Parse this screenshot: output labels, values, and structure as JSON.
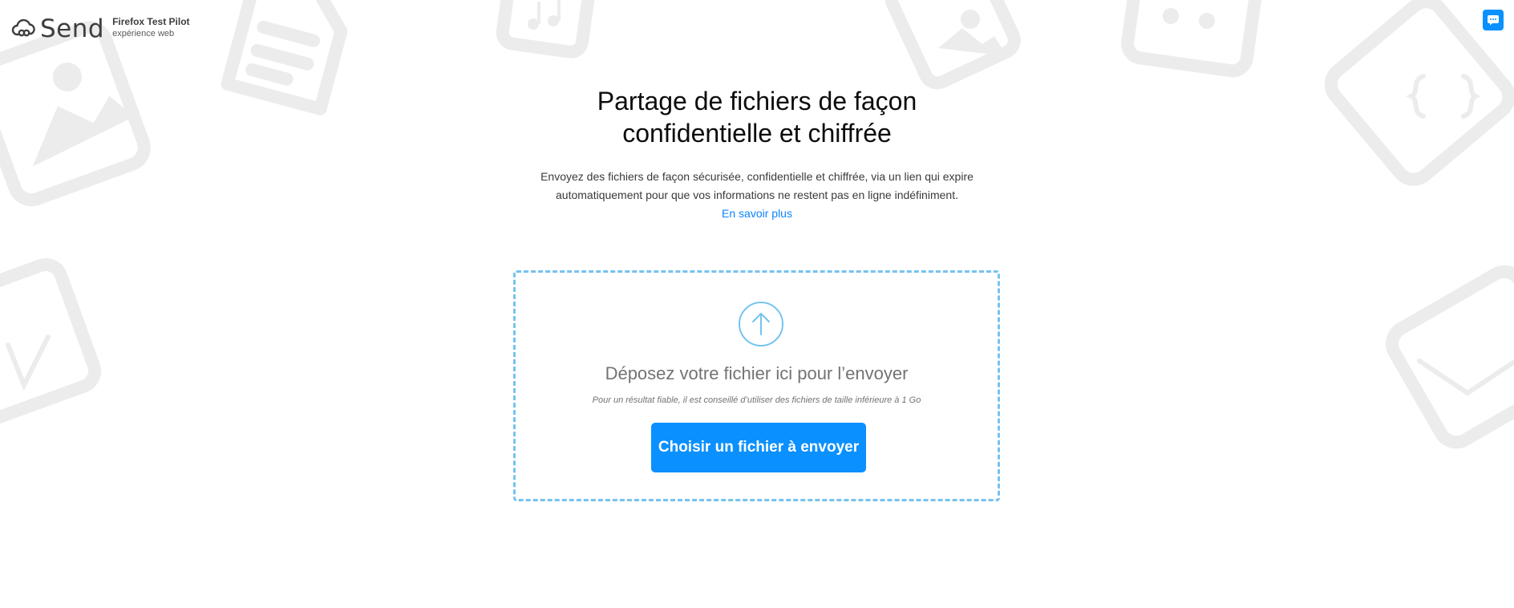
{
  "header": {
    "logo_text": "Send",
    "testpilot_title": "Firefox Test Pilot",
    "testpilot_subtitle": "expérience web"
  },
  "feedback": {
    "icon": "speech-bubble-icon"
  },
  "main": {
    "title_line1": "Partage de fichiers de façon",
    "title_line2": "confidentielle et chiffrée",
    "description_line1": "Envoyez des fichiers de façon sécurisée, confidentielle et chiffrée, via un lien qui expire",
    "description_line2": "automatiquement pour que vos informations ne restent pas en ligne indéfiniment.",
    "learn_more": "En savoir plus"
  },
  "dropzone": {
    "icon": "upload-arrow-icon",
    "drop_text": "Déposez votre fichier ici pour l’envoyer",
    "hint": "Pour un résultat fiable, il est conseillé d’utiliser des fichiers de taille inférieure à 1 Go",
    "button_label": "Choisir un fichier à envoyer"
  },
  "colors": {
    "accent": "#0a90ff",
    "dropzone_border": "#75c3f0",
    "background_art": "#ececed"
  }
}
